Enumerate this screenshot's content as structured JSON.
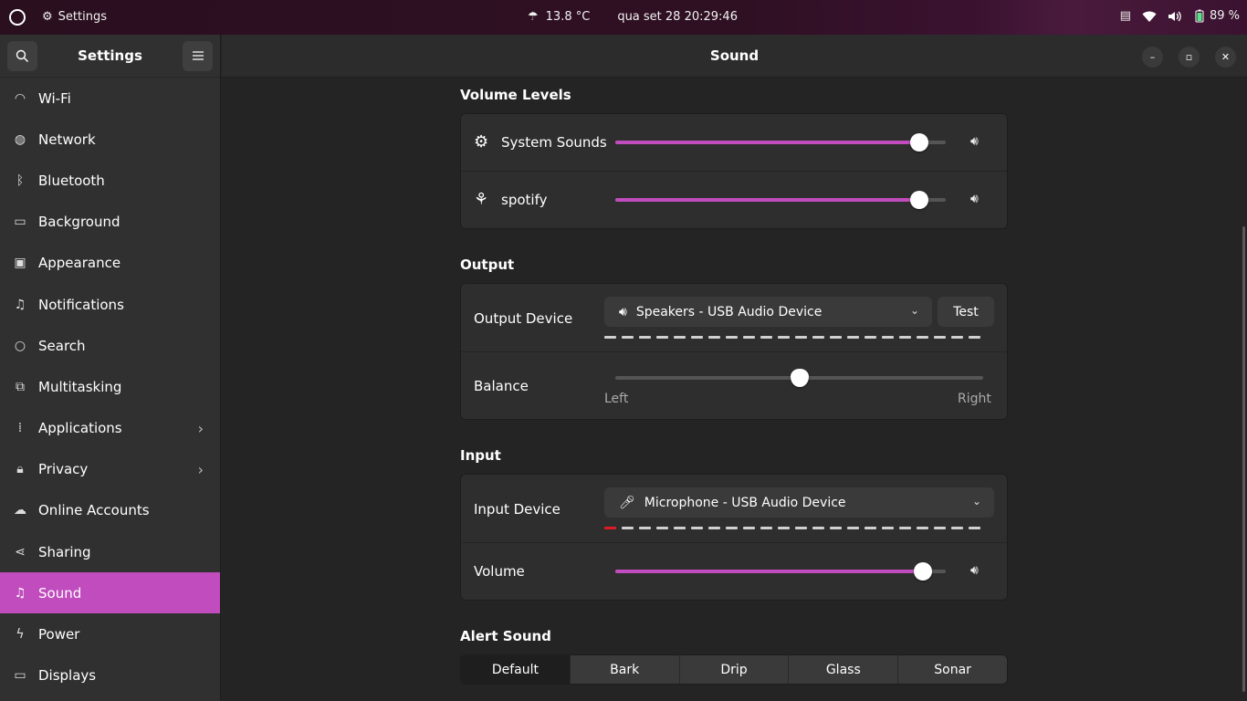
{
  "topbar": {
    "app_name": "Settings",
    "temperature": "13.8 °C",
    "datetime": "qua set 28  20:29:46",
    "battery": "89 %"
  },
  "sidebar": {
    "title": "Settings",
    "items": [
      {
        "label": "Wi-Fi",
        "icon": "wifi-icon"
      },
      {
        "label": "Network",
        "icon": "network-icon"
      },
      {
        "label": "Bluetooth",
        "icon": "bluetooth-icon"
      },
      {
        "label": "Background",
        "icon": "background-icon"
      },
      {
        "label": "Appearance",
        "icon": "appearance-icon"
      },
      {
        "label": "Notifications",
        "icon": "bell-icon"
      },
      {
        "label": "Search",
        "icon": "search-icon"
      },
      {
        "label": "Multitasking",
        "icon": "multitasking-icon"
      },
      {
        "label": "Applications",
        "icon": "grid-icon"
      },
      {
        "label": "Privacy",
        "icon": "lock-icon"
      },
      {
        "label": "Online Accounts",
        "icon": "cloud-icon"
      },
      {
        "label": "Sharing",
        "icon": "share-icon"
      },
      {
        "label": "Sound",
        "icon": "music-note-icon"
      },
      {
        "label": "Power",
        "icon": "power-icon"
      },
      {
        "label": "Displays",
        "icon": "display-icon"
      }
    ],
    "active": "Sound"
  },
  "main": {
    "title": "Sound",
    "volume_levels": {
      "title": "Volume Levels",
      "rows": [
        {
          "label": "System Sounds",
          "level": 0.92
        },
        {
          "label": "spotify",
          "level": 0.92
        }
      ]
    },
    "output": {
      "title": "Output",
      "device_label": "Output Device",
      "device": "Speakers - USB Audio Device",
      "test_label": "Test",
      "balance_label": "Balance",
      "balance_left": "Left",
      "balance_right": "Right",
      "balance_value": 0.5
    },
    "input": {
      "title": "Input",
      "device_label": "Input Device",
      "device": "Microphone - USB Audio Device",
      "volume_label": "Volume",
      "volume_level": 0.93
    },
    "alert_sound": {
      "title": "Alert Sound",
      "options": [
        "Default",
        "Bark",
        "Drip",
        "Glass",
        "Sonar"
      ],
      "selected": "Default"
    }
  },
  "colors": {
    "accent": "#c04cbd",
    "topbar": "#2a0f1f",
    "sidebar": "#303030",
    "background": "#242424"
  }
}
